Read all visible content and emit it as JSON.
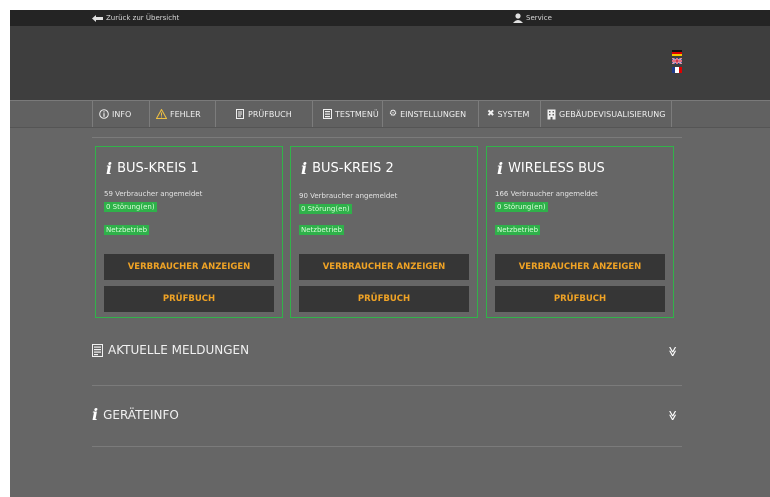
{
  "topbar": {
    "back_label": "Zurück zur Übersicht",
    "service_label": "Service"
  },
  "languages": [
    "de",
    "en",
    "fr"
  ],
  "nav": [
    {
      "label": "INFO",
      "icon": "info-circle-icon"
    },
    {
      "label": "FEHLER",
      "icon": "warning-icon"
    },
    {
      "label": "PRÜFBUCH",
      "icon": "logbook-icon"
    },
    {
      "label": "TESTMENÜ",
      "icon": "test-menu-icon"
    },
    {
      "label": "EINSTELLUNGEN",
      "icon": "gear-icon"
    },
    {
      "label": "SYSTEM",
      "icon": "tools-icon"
    },
    {
      "label": "GEBÄUDEVISUALISIERUNG",
      "icon": "building-icon"
    }
  ],
  "cards": [
    {
      "title": "BUS-KREIS 1",
      "consumers": "59 Verbraucher angemeldet",
      "faults": "0 Störung(en)",
      "mode": "Netzbetrieb",
      "btn_consumers": "VERBRAUCHER ANZEIGEN",
      "btn_log": "PRÜFBUCH"
    },
    {
      "title": "BUS-KREIS 2",
      "consumers": "90 Verbraucher angemeldet",
      "faults": "0 Störung(en)",
      "mode": "Netzbetrieb",
      "btn_consumers": "VERBRAUCHER ANZEIGEN",
      "btn_log": "PRÜFBUCH"
    },
    {
      "title": "WIRELESS BUS",
      "consumers": "166 Verbraucher angemeldet",
      "faults": "0 Störung(en)",
      "mode": "Netzbetrieb",
      "btn_consumers": "VERBRAUCHER ANZEIGEN",
      "btn_log": "PRÜFBUCH"
    }
  ],
  "sections": [
    {
      "title": "AKTUELLE MELDUNGEN",
      "icon": "messages-icon"
    },
    {
      "title": "GERÄTEINFO",
      "icon": "info-icon"
    }
  ],
  "colors": {
    "accent_green": "#32b24a",
    "button_text": "#f0a325",
    "button_bg": "#363636"
  }
}
